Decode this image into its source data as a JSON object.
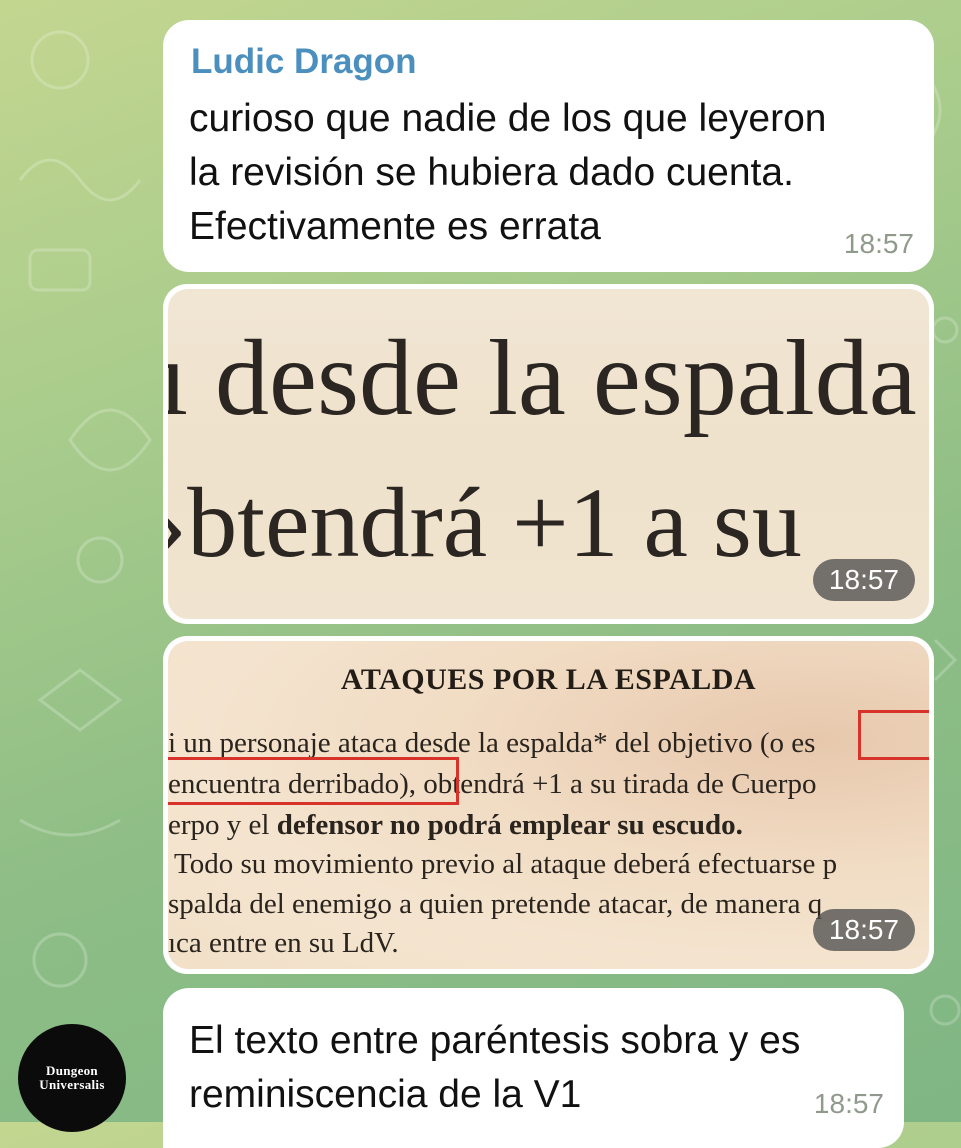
{
  "colors": {
    "sender_name": "#4a8fbd",
    "bubble_bg": "#ffffff",
    "highlight_box": "#d8332a"
  },
  "messages": [
    {
      "sender": "Ludic Dragon",
      "text": "curioso que nadie de los que leyeron\nla revisión se hubiera dado cuenta.\nEfectivamente es errata",
      "time": "18:57"
    },
    {
      "type": "image",
      "image_text": {
        "line1": "ı desde la espalda",
        "line2": "›btendrá +1 a su"
      },
      "time": "18:57"
    },
    {
      "type": "image",
      "image_text": {
        "heading": "ATAQUES POR LA ESPALDA",
        "line1_a": "i un personaje ataca desde la espalda* del objetivo",
        "line1_b": "(o es",
        "line2_a": "encuentra derribado),",
        "line2_b": "obtendrá +1 a su tirada de Cuerpo",
        "line3_a": "erpo y el ",
        "line3_b": "defensor no podrá emplear su escudo.",
        "line4": "Todo su movimiento previo al ataque deberá efectuarse p",
        "line5": "spalda del enemigo a quien pretende atacar, de manera q",
        "line6": "ıca entre en su LdV."
      },
      "time": "18:57"
    },
    {
      "text": "El texto entre paréntesis sobra y es\nreminiscencia de la V1",
      "time": "18:57"
    }
  ],
  "avatar": {
    "line1": "Dungeon",
    "line2": "Universalis"
  }
}
